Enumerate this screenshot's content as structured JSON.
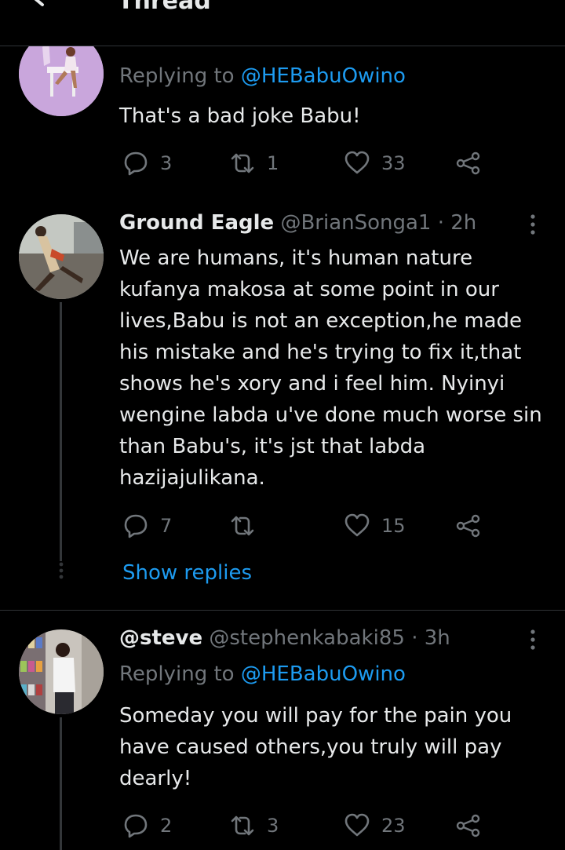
{
  "topbar": {
    "title": "Thread"
  },
  "tweets": [
    {
      "reply_prefix": "Replying to ",
      "reply_to": "@HEBabuOwino",
      "text": "That's a bad joke Babu!",
      "replies": "3",
      "retweets": "1",
      "likes": "33"
    },
    {
      "display_name": "Ground Eagle",
      "handle": "@BrianSonga1",
      "time": "· 2h",
      "text": "We are humans, it's human nature kufanya makosa at some point in our lives,Babu is not an exception,he made his mistake and he's trying to fix it,that shows he's xory and i feel him. Nyinyi wengine labda u've done much worse sin than Babu's, it's jst that labda hazijajulikana.",
      "replies": "7",
      "retweets": "",
      "likes": "15",
      "show_replies": "Show replies"
    },
    {
      "display_name": "@steve",
      "handle": "@stephenkabaki85",
      "time": "· 3h",
      "reply_prefix": "Replying to ",
      "reply_to": "@HEBabuOwino",
      "text": "Someday you will pay for the pain you have caused others,you truly will pay dearly!",
      "replies": "2",
      "retweets": "3",
      "likes": "23"
    }
  ],
  "colors": {
    "accent": "#1d9bf0",
    "muted": "#71767b",
    "background": "#000000",
    "text": "#e7e9ea"
  }
}
